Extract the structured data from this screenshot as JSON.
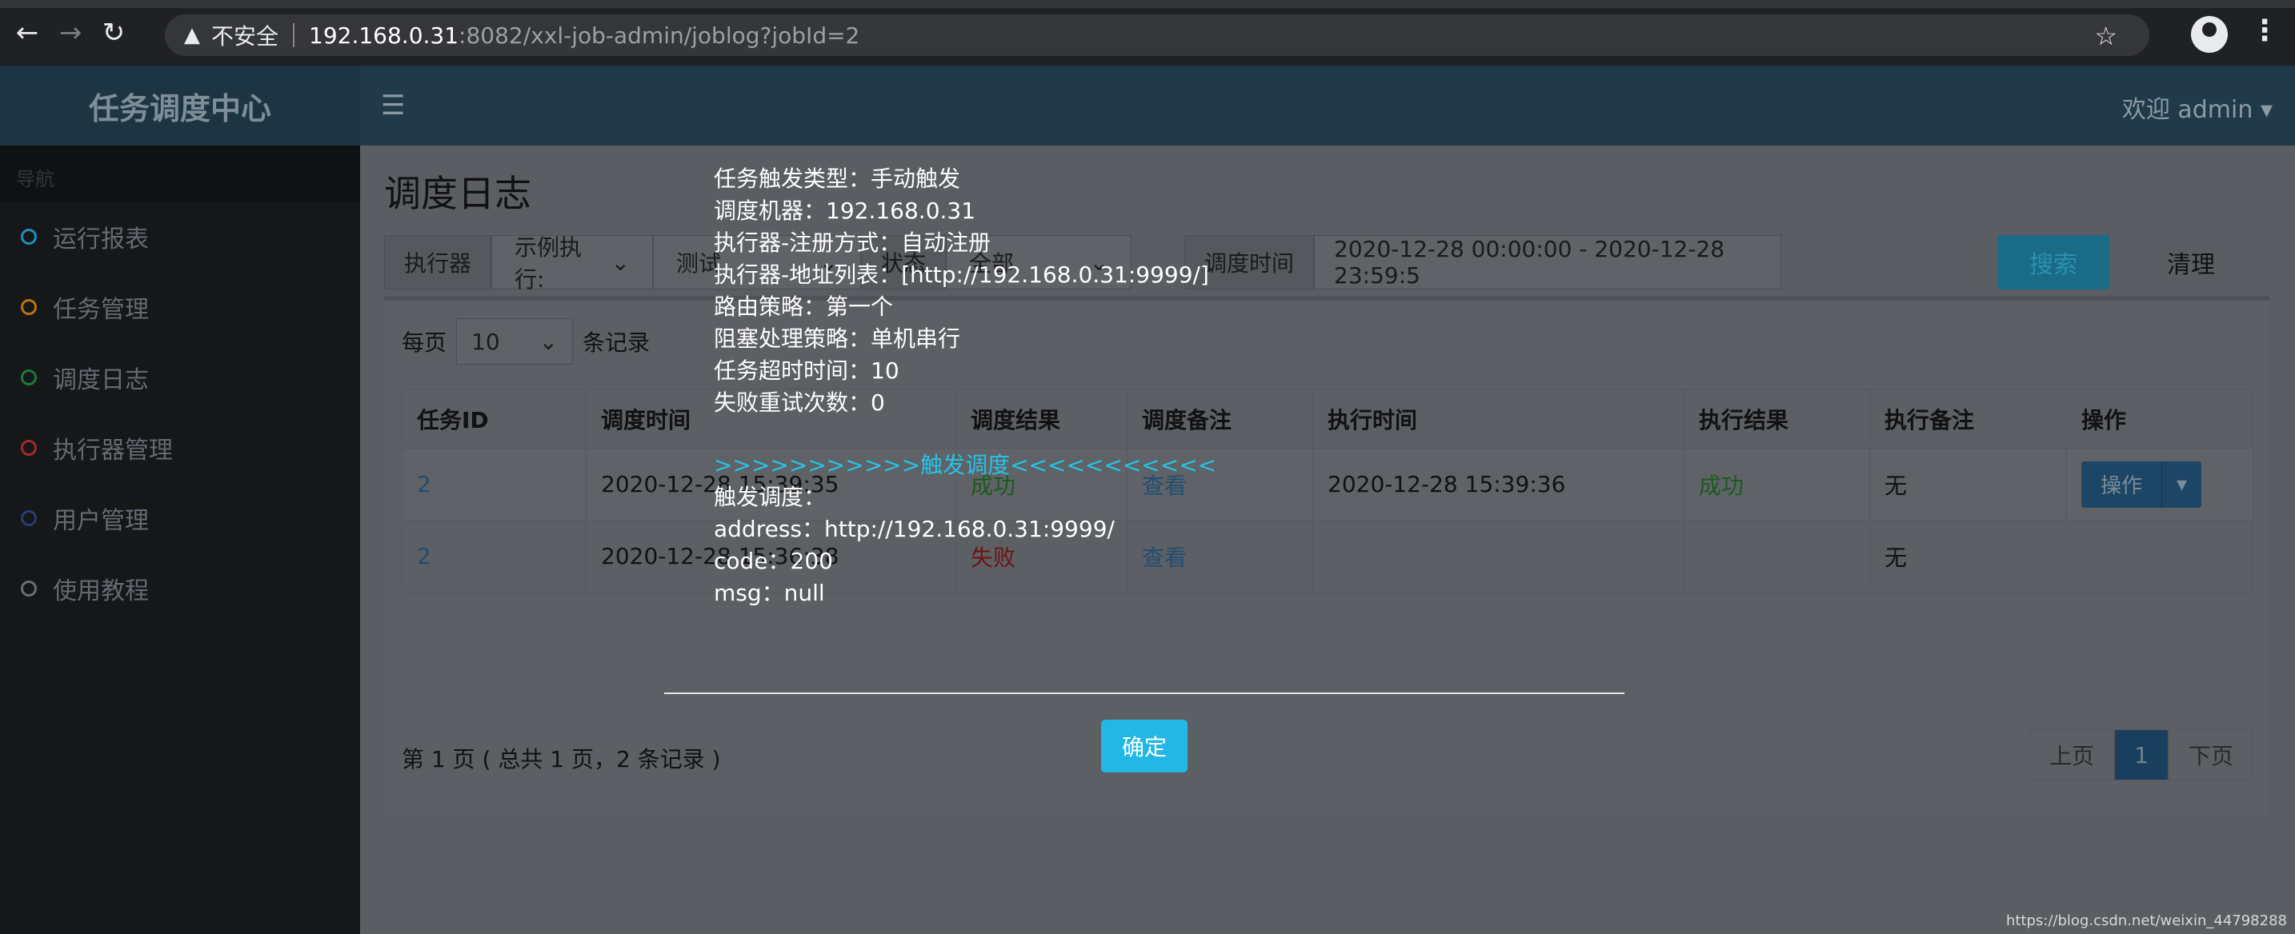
{
  "browser": {
    "security_label": "不安全",
    "url_host": "192.168.0.31",
    "url_path": ":8082/xxl-job-admin/joblog?jobId=2"
  },
  "header": {
    "app_title": "任务调度中心",
    "welcome": "欢迎 admin"
  },
  "sidebar": {
    "section": "导航",
    "items": [
      {
        "label": "运行报表",
        "color": "#1b8fb8"
      },
      {
        "label": "任务管理",
        "color": "#b8740e"
      },
      {
        "label": "调度日志",
        "color": "#1b7a3a"
      },
      {
        "label": "执行器管理",
        "color": "#a12a2a"
      },
      {
        "label": "用户管理",
        "color": "#2a3a7a"
      },
      {
        "label": "使用教程",
        "color": "#6a6e72"
      }
    ]
  },
  "page": {
    "title": "调度日志",
    "filters": {
      "executor_label": "执行器",
      "executor_value": "示例执行:",
      "task_value": "测试",
      "status_label": "状态",
      "status_value": "全部",
      "time_label": "调度时间",
      "time_value": "2020-12-28 00:00:00 - 2020-12-28 23:59:5"
    },
    "search_button": "搜索",
    "clear_button": "清理",
    "perpage_prefix": "每页",
    "perpage_value": "10",
    "perpage_suffix": "条记录"
  },
  "table": {
    "headers": [
      "任务ID",
      "调度时间",
      "调度结果",
      "调度备注",
      "执行时间",
      "执行结果",
      "执行备注",
      "操作"
    ],
    "rows": [
      {
        "id": "2",
        "time": "2020-12-28 15:39:35",
        "result": "成功",
        "remark": "查看",
        "exec_time": "2020-12-28 15:39:36",
        "exec_result": "成功",
        "exec_remark": "无",
        "op": "操作"
      },
      {
        "id": "2",
        "time": "2020-12-28 15:36:38",
        "result": "失败",
        "remark": "查看",
        "exec_time": "",
        "exec_result": "",
        "exec_remark": "无",
        "op": ""
      }
    ]
  },
  "pagination": {
    "info": "第 1 页 ( 总共 1 页，2 条记录 )",
    "prev": "上页",
    "current": "1",
    "next": "下页"
  },
  "dialog": {
    "lines": [
      "任务触发类型：手动触发",
      "调度机器：192.168.0.31",
      "执行器-注册方式：自动注册",
      "执行器-地址列表：[http://192.168.0.31:9999/]",
      "路由策略：第一个",
      "阻塞处理策略：单机串行",
      "任务超时时间：10",
      "失败重试次数：0"
    ],
    "trigger_line": ">>>>>>>>>>>触发调度<<<<<<<<<<<",
    "result_lines": [
      "触发调度：",
      "address：http://192.168.0.31:9999/",
      "code：200",
      "msg：null"
    ],
    "ok_button": "确定"
  },
  "watermark": "https://blog.csdn.net/weixin_44798288"
}
